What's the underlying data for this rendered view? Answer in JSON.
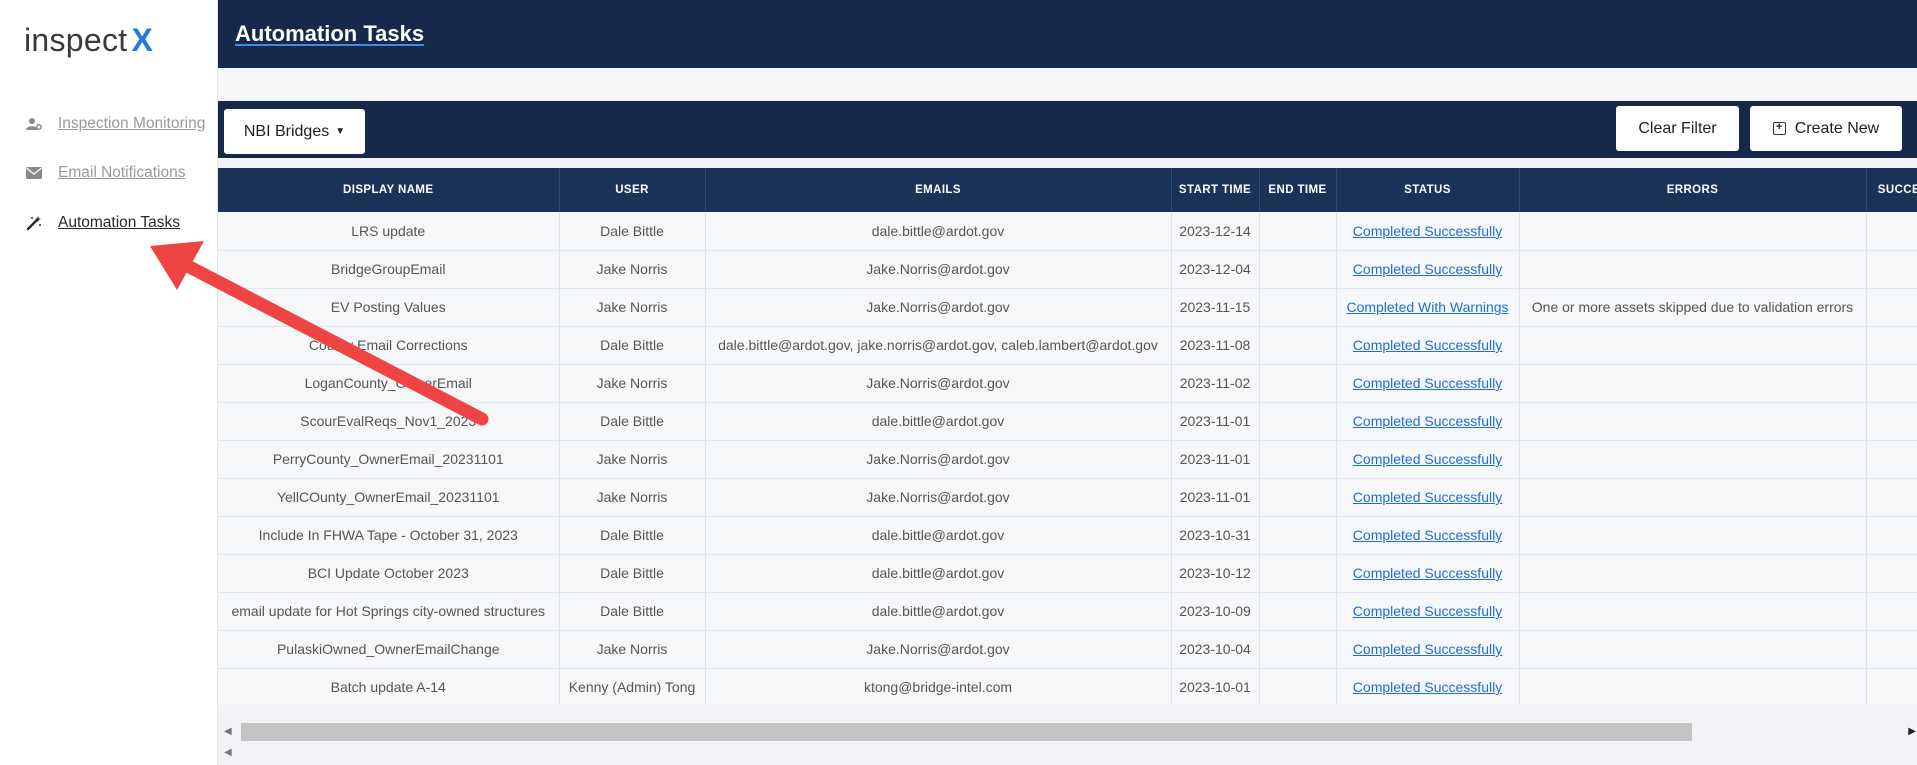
{
  "app": {
    "logo_text": "inspect",
    "logo_accent": "X",
    "accent_color": "#1f7ad9"
  },
  "sidebar": {
    "items": [
      {
        "label": "Inspection Monitoring",
        "icon": "user-gear-icon",
        "active": false
      },
      {
        "label": "Email Notifications",
        "icon": "envelope-icon",
        "active": false
      },
      {
        "label": "Automation Tasks",
        "icon": "magic-wand-icon",
        "active": true
      }
    ]
  },
  "header": {
    "title": "Automation Tasks",
    "bg_color": "#16294b"
  },
  "toolbar": {
    "filter_dropdown": "NBI Bridges",
    "clear_filter": "Clear Filter",
    "create_new": "Create New"
  },
  "table": {
    "columns": [
      "DISPLAY NAME",
      "USER",
      "EMAILS",
      "START TIME",
      "END TIME",
      "STATUS",
      "ERRORS",
      "SUCCESS"
    ],
    "rows": [
      {
        "display_name": "LRS update",
        "user": "Dale Bittle",
        "emails": "dale.bittle@ardot.gov",
        "start": "2023-12-14",
        "end": "",
        "status": "Completed Successfully",
        "errors": ""
      },
      {
        "display_name": "BridgeGroupEmail",
        "user": "Jake Norris",
        "emails": "Jake.Norris@ardot.gov",
        "start": "2023-12-04",
        "end": "",
        "status": "Completed Successfully",
        "errors": ""
      },
      {
        "display_name": "EV Posting Values",
        "user": "Jake Norris",
        "emails": "Jake.Norris@ardot.gov",
        "start": "2023-11-15",
        "end": "",
        "status": "Completed With Warnings",
        "errors": "One or more assets skipped due to validation errors"
      },
      {
        "display_name": "County Email Corrections",
        "user": "Dale Bittle",
        "emails": "dale.bittle@ardot.gov, jake.norris@ardot.gov, caleb.lambert@ardot.gov",
        "start": "2023-11-08",
        "end": "",
        "status": "Completed Successfully",
        "errors": ""
      },
      {
        "display_name": "LoganCounty_OwnerEmail",
        "user": "Jake Norris",
        "emails": "Jake.Norris@ardot.gov",
        "start": "2023-11-02",
        "end": "",
        "status": "Completed Successfully",
        "errors": ""
      },
      {
        "display_name": "ScourEvalReqs_Nov1_2023",
        "user": "Dale Bittle",
        "emails": "dale.bittle@ardot.gov",
        "start": "2023-11-01",
        "end": "",
        "status": "Completed Successfully",
        "errors": ""
      },
      {
        "display_name": "PerryCounty_OwnerEmail_20231101",
        "user": "Jake Norris",
        "emails": "Jake.Norris@ardot.gov",
        "start": "2023-11-01",
        "end": "",
        "status": "Completed Successfully",
        "errors": ""
      },
      {
        "display_name": "YellCOunty_OwnerEmail_20231101",
        "user": "Jake Norris",
        "emails": "Jake.Norris@ardot.gov",
        "start": "2023-11-01",
        "end": "",
        "status": "Completed Successfully",
        "errors": ""
      },
      {
        "display_name": "Include In FHWA Tape - October 31, 2023",
        "user": "Dale Bittle",
        "emails": "dale.bittle@ardot.gov",
        "start": "2023-10-31",
        "end": "",
        "status": "Completed Successfully",
        "errors": ""
      },
      {
        "display_name": "BCI Update October 2023",
        "user": "Dale Bittle",
        "emails": "dale.bittle@ardot.gov",
        "start": "2023-10-12",
        "end": "",
        "status": "Completed Successfully",
        "errors": ""
      },
      {
        "display_name": "email update for Hot Springs city-owned structures",
        "user": "Dale Bittle",
        "emails": "dale.bittle@ardot.gov",
        "start": "2023-10-09",
        "end": "",
        "status": "Completed Successfully",
        "errors": ""
      },
      {
        "display_name": "PulaskiOwned_OwnerEmailChange",
        "user": "Jake Norris",
        "emails": "Jake.Norris@ardot.gov",
        "start": "2023-10-04",
        "end": "",
        "status": "Completed Successfully",
        "errors": ""
      },
      {
        "display_name": "Batch update A-14",
        "user": "Kenny (Admin) Tong",
        "emails": "ktong@bridge-intel.com",
        "start": "2023-10-01",
        "end": "",
        "status": "Completed Successfully",
        "errors": ""
      }
    ]
  },
  "annotation": {
    "arrow_color": "#ef4444"
  }
}
